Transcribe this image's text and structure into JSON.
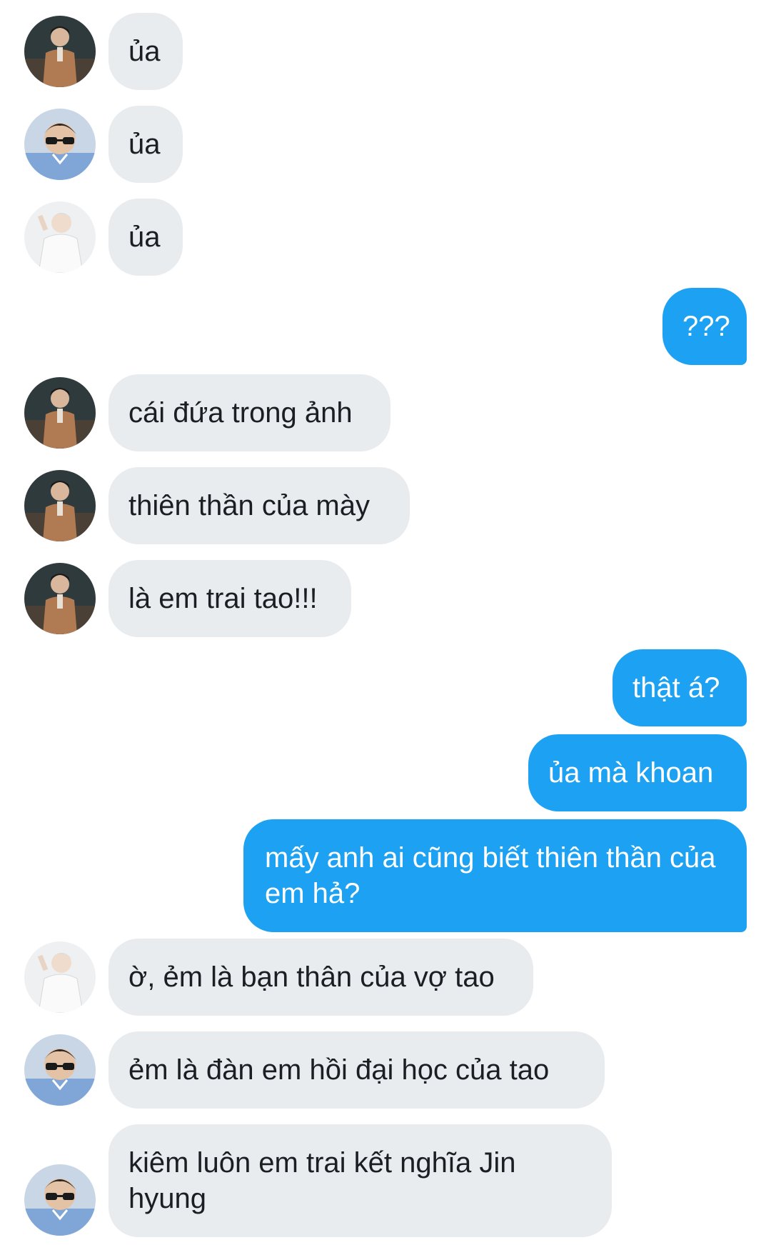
{
  "colors": {
    "incoming_bubble": "#e9ecef",
    "outgoing_bubble": "#1da1f2",
    "incoming_text": "#1b1f23",
    "outgoing_text": "#ffffff"
  },
  "avatars": {
    "a": "avatar-brown-suit",
    "b": "avatar-sunglasses",
    "c": "avatar-white-hair"
  },
  "messages": [
    {
      "from": "in",
      "avatar": "a",
      "text": "ủa"
    },
    {
      "from": "in",
      "avatar": "b",
      "text": "ủa"
    },
    {
      "from": "in",
      "avatar": "c",
      "text": "ủa"
    },
    {
      "from": "out",
      "text": "???"
    },
    {
      "from": "in",
      "avatar": "a",
      "text": "cái đứa trong ảnh"
    },
    {
      "from": "in",
      "avatar": "a",
      "text": "thiên thần của mày"
    },
    {
      "from": "in",
      "avatar": "a",
      "text": "là em trai tao!!!"
    },
    {
      "from": "out",
      "text": "thật á?"
    },
    {
      "from": "out",
      "text": "ủa mà khoan"
    },
    {
      "from": "out",
      "text": "mấy anh ai cũng biết thiên thần của em hả?"
    },
    {
      "from": "in",
      "avatar": "c",
      "text": "ờ, ẻm là bạn thân của vợ tao"
    },
    {
      "from": "in",
      "avatar": "b",
      "text": "ẻm là đàn em hồi đại học của tao"
    },
    {
      "from": "in",
      "avatar": "b",
      "text": "kiêm luôn em trai kết nghĩa Jin hyung"
    }
  ]
}
